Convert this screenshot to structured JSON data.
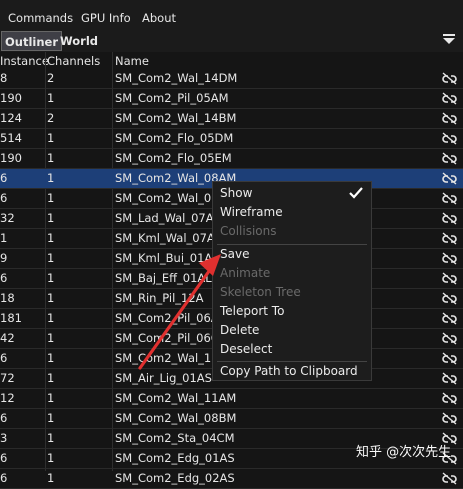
{
  "menubar": {
    "items": [
      "Commands",
      "GPU Info",
      "About"
    ]
  },
  "tabs": [
    {
      "label": "Outliner",
      "active": true
    },
    {
      "label": "World",
      "active": false
    }
  ],
  "columns": {
    "instance": "Instance",
    "channels": "Channels",
    "name": "Name"
  },
  "rows": [
    {
      "instance": "8",
      "channels": "2",
      "name": "SM_Com2_Wal_14DM"
    },
    {
      "instance": "190",
      "channels": "1",
      "name": "SM_Com2_Pil_05AM"
    },
    {
      "instance": "124",
      "channels": "2",
      "name": "SM_Com2_Wal_14BM"
    },
    {
      "instance": "514",
      "channels": "1",
      "name": "SM_Com2_Flo_05DM"
    },
    {
      "instance": "190",
      "channels": "1",
      "name": "SM_Com2_Flo_05EM"
    },
    {
      "instance": "6",
      "channels": "1",
      "name": "SM_Com2_Wal_08AM",
      "selected": true
    },
    {
      "instance": "6",
      "channels": "1",
      "name": "SM_Com2_Wal_08C"
    },
    {
      "instance": "32",
      "channels": "1",
      "name": "SM_Lad_Wal_07AM"
    },
    {
      "instance": "1",
      "channels": "1",
      "name": "SM_Kml_Wal_07AM"
    },
    {
      "instance": "9",
      "channels": "1",
      "name": "SM_Kml_Bui_01AL"
    },
    {
      "instance": "6",
      "channels": "1",
      "name": "SM_Baj_Eff_01AL"
    },
    {
      "instance": "18",
      "channels": "1",
      "name": "SM_Rin_Pil_12A"
    },
    {
      "instance": "181",
      "channels": "1",
      "name": "SM_Com2_Pil_06AM"
    },
    {
      "instance": "42",
      "channels": "1",
      "name": "SM_Com2_Pil_06CM"
    },
    {
      "instance": "6",
      "channels": "1",
      "name": "SM_Com2_Wal_15A"
    },
    {
      "instance": "72",
      "channels": "1",
      "name": "SM_Air_Lig_01AS"
    },
    {
      "instance": "12",
      "channels": "1",
      "name": "SM_Com2_Wal_11AM"
    },
    {
      "instance": "6",
      "channels": "1",
      "name": "SM_Com2_Wal_08BM"
    },
    {
      "instance": "3",
      "channels": "1",
      "name": "SM_Com2_Sta_04CM"
    },
    {
      "instance": "6",
      "channels": "1",
      "name": "SM_Com2_Edg_01AS"
    },
    {
      "instance": "6",
      "channels": "1",
      "name": "SM_Com2_Edg_02AS"
    }
  ],
  "context_menu": {
    "show": "Show",
    "wireframe": "Wireframe",
    "collisions": "Collisions",
    "save": "Save",
    "animate": "Animate",
    "skeleton_tree": "Skeleton Tree",
    "teleport_to": "Teleport To",
    "delete": "Delete",
    "deselect": "Deselect",
    "copy_path": "Copy Path to Clipboard"
  },
  "icons": {
    "row_action": "chain-link-icon",
    "filter": "filter-funnel-icon",
    "checked": "checkmark-icon"
  },
  "colors": {
    "selection": "#1d3f78",
    "arrow": "#e0302f",
    "background": "#151515"
  },
  "watermark": "知乎 @次次先生"
}
